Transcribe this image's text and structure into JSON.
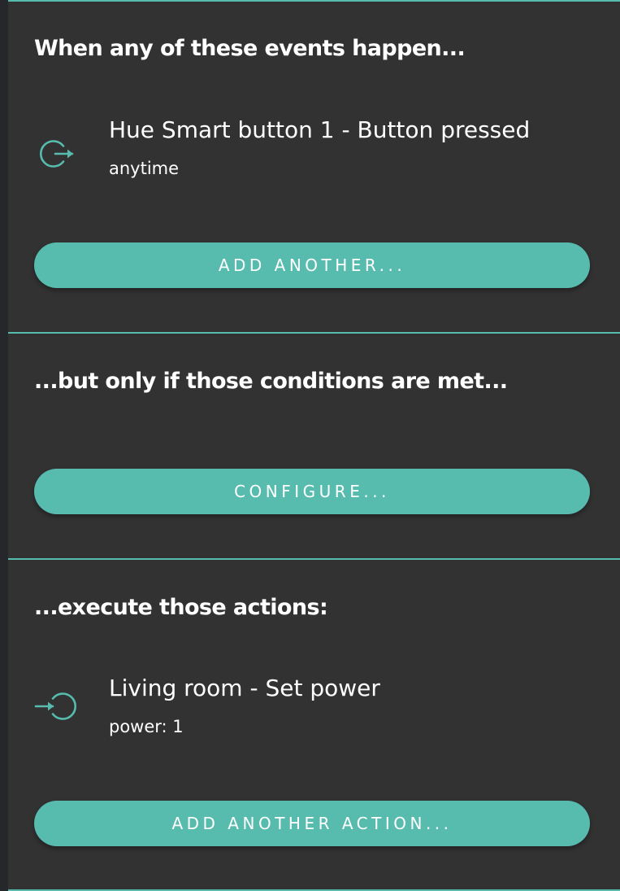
{
  "colors": {
    "accent": "#57bbae",
    "panel_background": "#323233",
    "page_background": "#25272a",
    "text": "#ffffff"
  },
  "events": {
    "heading": "When any of these events happen...",
    "items": [
      {
        "icon": "event-trigger-icon",
        "title": "Hue Smart button 1 - Button pressed",
        "subtitle": "anytime"
      }
    ],
    "add_button_label": "ADD ANOTHER..."
  },
  "conditions": {
    "heading": "...but only if those conditions are met...",
    "configure_button_label": "CONFIGURE..."
  },
  "actions": {
    "heading": "...execute those actions:",
    "items": [
      {
        "icon": "action-execute-icon",
        "title": "Living room - Set power",
        "subtitle": "power: 1"
      }
    ],
    "add_button_label": "ADD ANOTHER ACTION..."
  }
}
